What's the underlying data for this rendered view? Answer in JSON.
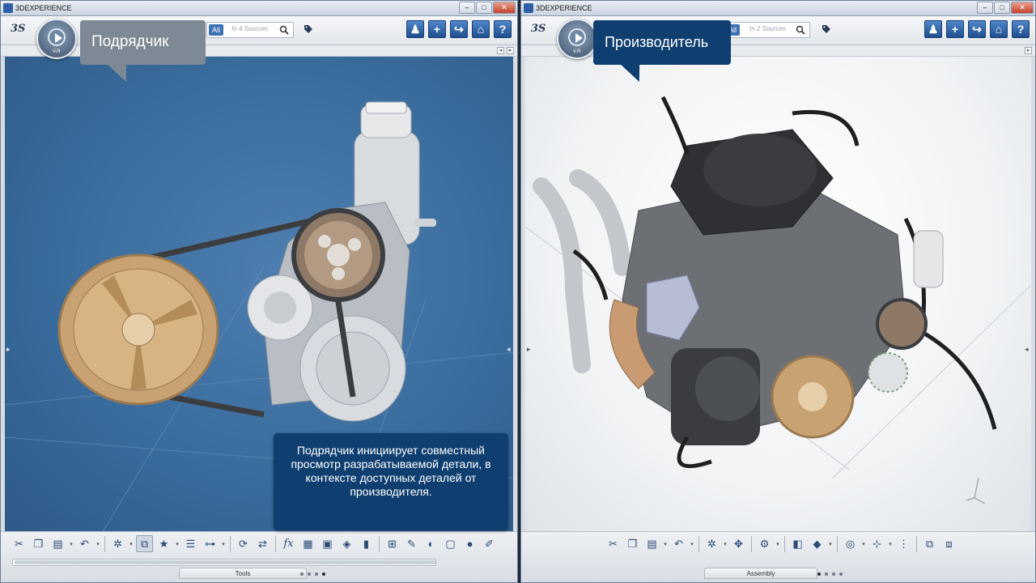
{
  "left_window": {
    "title": "3DEXPERIENCE",
    "search": {
      "filter": "All",
      "placeholder": "In 4 Sources"
    },
    "callout": "Подрядчик",
    "caption": "Подрядчик инициирует совместный просмотр разрабатываемой детали, в контексте доступных деталей  от производителя.",
    "section_tab": "Tools"
  },
  "right_window": {
    "title": "3DEXPERIENCE",
    "search": {
      "filter": "All",
      "placeholder": "In 2 Sources"
    },
    "callout": "Производитель",
    "section_tab": "Assembly"
  },
  "icons": {
    "toolbar_top": [
      "user-icon",
      "add-icon",
      "share-icon",
      "home-icon",
      "help-icon"
    ],
    "top_glyphs": {
      "add": "+",
      "help": "?"
    },
    "compass_label": "V.R"
  },
  "colors": {
    "left_viewport": "#3a6c9e",
    "callout_left": "#7d8994",
    "callout_right": "#0f3f70",
    "pulley_wood": "#c9a273"
  }
}
